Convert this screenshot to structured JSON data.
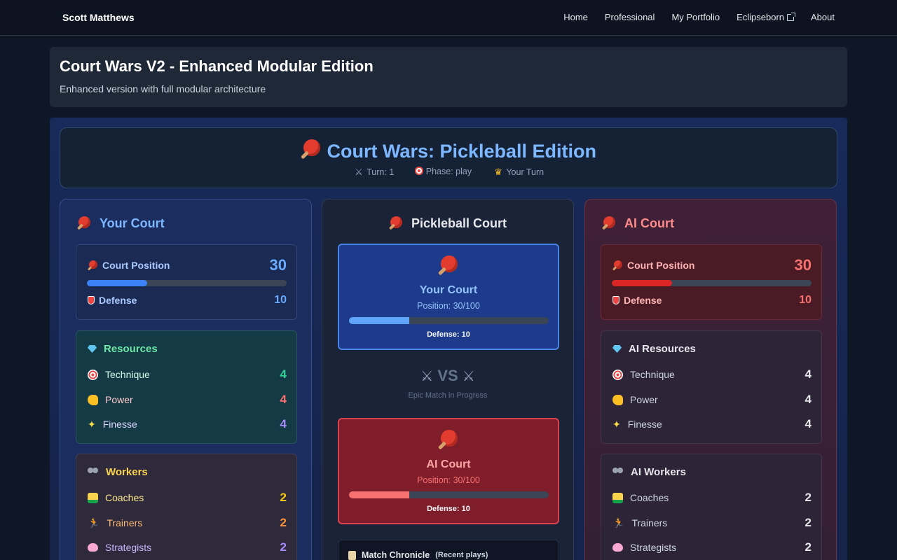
{
  "nav": {
    "brand": "Scott Matthews",
    "links": [
      "Home",
      "Professional",
      "My Portfolio",
      "Eclipseborn",
      "About"
    ]
  },
  "header": {
    "title": "Court Wars V2 - Enhanced Modular Edition",
    "subtitle": "Enhanced version with full modular architecture"
  },
  "game": {
    "title": "Court Wars: Pickleball Edition",
    "turn": "Turn: 1",
    "phase": "Phase: play",
    "status": "Your Turn"
  },
  "player": {
    "title": "Your Court",
    "position_label": "Court Position",
    "position": "30",
    "position_fraction": 0.3,
    "defense_label": "Defense",
    "defense": "10",
    "resources_title": "Resources",
    "resources": [
      {
        "label": "Technique",
        "value": "4"
      },
      {
        "label": "Power",
        "value": "4"
      },
      {
        "label": "Finesse",
        "value": "4"
      }
    ],
    "workers_title": "Workers",
    "workers": [
      {
        "label": "Coaches",
        "value": "2"
      },
      {
        "label": "Trainers",
        "value": "2"
      },
      {
        "label": "Strategists",
        "value": "2"
      }
    ]
  },
  "court": {
    "title": "Pickleball Court",
    "you_name": "Your Court",
    "you_position": "Position: 30/100",
    "you_fraction": 0.3,
    "you_defense": "Defense: 10",
    "vs_label": "VS",
    "vs_sub": "Epic Match in Progress",
    "ai_name": "AI Court",
    "ai_position": "Position: 30/100",
    "ai_fraction": 0.3,
    "ai_defense": "Defense: 10",
    "chronicle_title": "Match Chronicle",
    "chronicle_sub": "(Recent plays)"
  },
  "ai": {
    "title": "AI Court",
    "position_label": "Court Position",
    "position": "30",
    "position_fraction": 0.3,
    "defense_label": "Defense",
    "defense": "10",
    "resources_title": "AI Resources",
    "resources": [
      {
        "label": "Technique",
        "value": "4"
      },
      {
        "label": "Power",
        "value": "4"
      },
      {
        "label": "Finesse",
        "value": "4"
      }
    ],
    "workers_title": "AI Workers",
    "workers": [
      {
        "label": "Coaches",
        "value": "2"
      },
      {
        "label": "Trainers",
        "value": "2"
      },
      {
        "label": "Strategists",
        "value": "2"
      }
    ]
  },
  "icons": {
    "paddle": "pickleball-paddle-icon",
    "turn": "crossed-swords-icon",
    "phase": "target-icon",
    "status": "crown-icon",
    "defense": "shield-icon",
    "resources": "gem-icon",
    "workers": "people-icon",
    "chronicle": "scroll-icon"
  }
}
